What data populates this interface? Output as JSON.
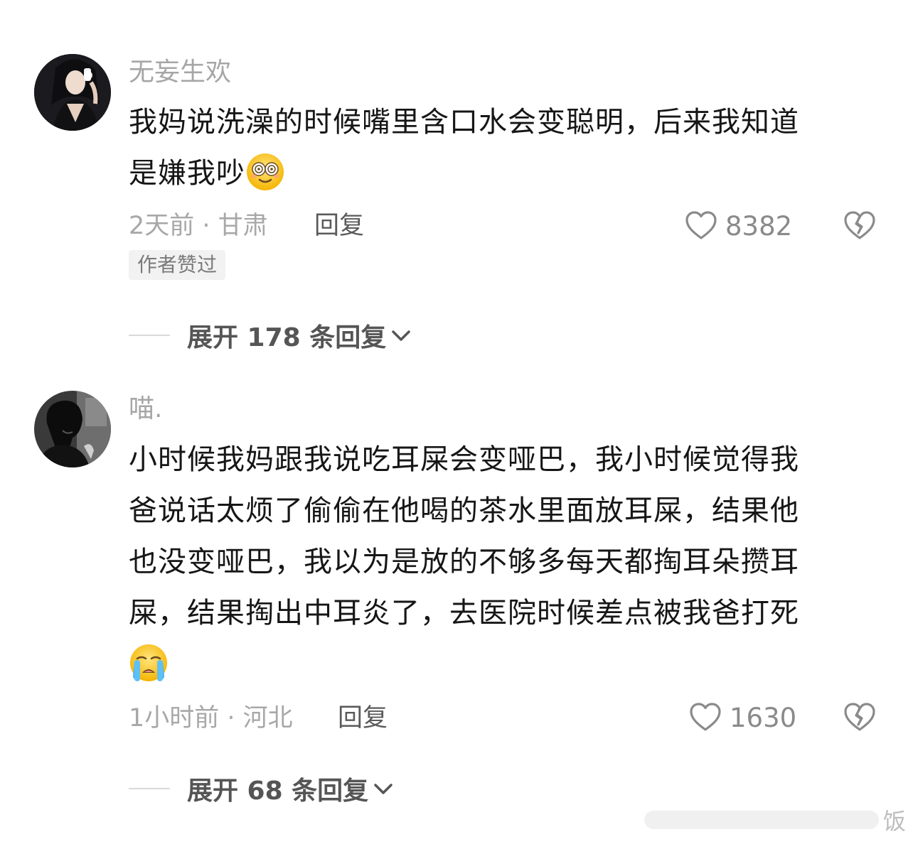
{
  "comments": [
    {
      "username": "无妄生欢",
      "lines": [
        "我妈说洗澡的时候嘴里含口水会变聪明，后来我知道",
        "是嫌我吵"
      ],
      "emoji": "dizzy-eyes-face",
      "time_location": "2天前 · 甘肃",
      "reply_label": "回复",
      "likes": "8382",
      "badge": "作者赞过",
      "expand_label": "展开 178 条回复"
    },
    {
      "username": "喵.",
      "lines": [
        "小时候我妈跟我说吃耳屎会变哑巴，我小时候觉得我",
        "爸说话太烦了偷偷在他喝的茶水里面放耳屎，结果他",
        "也没变哑巴，我以为是放的不够多每天都掏耳朵攒耳",
        "屎，结果掏出中耳炎了，去医院时候差点被我爸打死"
      ],
      "emoji": "loudly-crying-face",
      "time_location": "1小时前 · 河北",
      "reply_label": "回复",
      "likes": "1630",
      "expand_label": "展开 68 条回复"
    }
  ],
  "watermark": {
    "text": "饭"
  },
  "colors": {
    "username": "#a6a6a6",
    "body": "#161616",
    "meta": "#a8a8a8",
    "expand": "#555555"
  }
}
